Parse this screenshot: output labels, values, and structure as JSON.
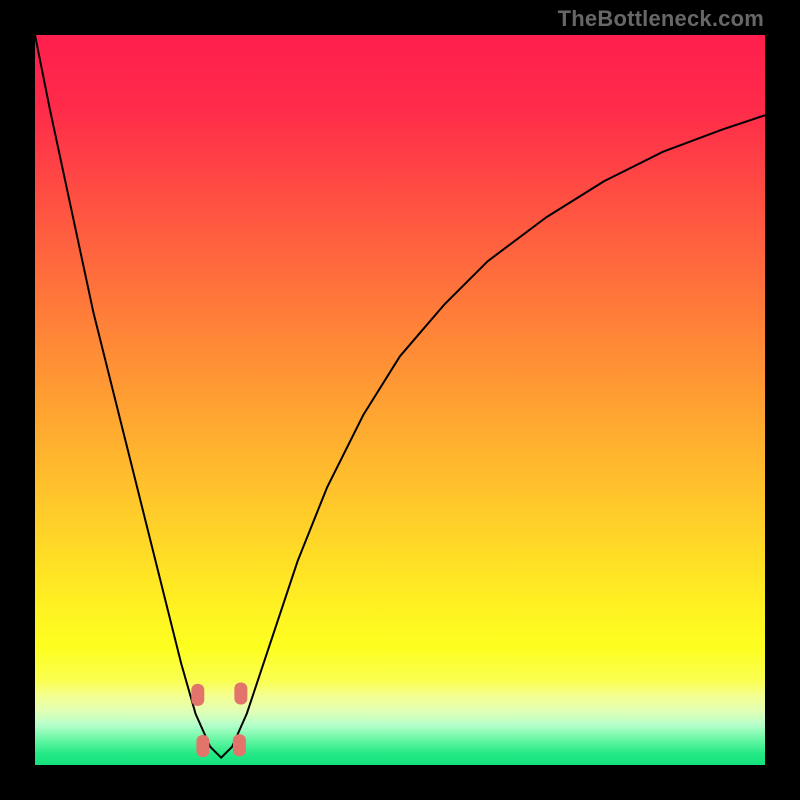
{
  "watermark": {
    "text": "TheBottleneck.com"
  },
  "gradient": {
    "stops": [
      {
        "offset": 0.0,
        "color": "#ff1f4e"
      },
      {
        "offset": 0.1,
        "color": "#ff2b4a"
      },
      {
        "offset": 0.2,
        "color": "#ff4844"
      },
      {
        "offset": 0.3,
        "color": "#ff653e"
      },
      {
        "offset": 0.4,
        "color": "#ff8238"
      },
      {
        "offset": 0.5,
        "color": "#ff9f32"
      },
      {
        "offset": 0.6,
        "color": "#ffbc2d"
      },
      {
        "offset": 0.7,
        "color": "#ffd927"
      },
      {
        "offset": 0.78,
        "color": "#fff022"
      },
      {
        "offset": 0.84,
        "color": "#fdff20"
      },
      {
        "offset": 0.885,
        "color": "#faff52"
      },
      {
        "offset": 0.905,
        "color": "#f4ff90"
      },
      {
        "offset": 0.925,
        "color": "#e3ffb4"
      },
      {
        "offset": 0.945,
        "color": "#b6ffcb"
      },
      {
        "offset": 0.965,
        "color": "#68f7a4"
      },
      {
        "offset": 0.985,
        "color": "#23e985"
      },
      {
        "offset": 1.0,
        "color": "#13e17c"
      }
    ]
  },
  "chart_data": {
    "type": "line",
    "title": "",
    "xlabel": "",
    "ylabel": "",
    "xlim": [
      0,
      100
    ],
    "ylim": [
      0,
      100
    ],
    "series": [
      {
        "name": "bottleneck-curve",
        "x": [
          0,
          2,
          5,
          8,
          12,
          16,
          20,
          22,
          24,
          25.5,
          27,
          29,
          32,
          36,
          40,
          45,
          50,
          56,
          62,
          70,
          78,
          86,
          94,
          100
        ],
        "y": [
          100,
          90,
          76,
          62,
          46,
          30,
          14,
          7,
          2.5,
          1,
          2.5,
          7,
          16,
          28,
          38,
          48,
          56,
          63,
          69,
          75,
          80,
          84,
          87,
          89
        ]
      }
    ],
    "markers": {
      "name": "pink-dots",
      "x": [
        22.3,
        23.0,
        28.0,
        28.2
      ],
      "y": [
        9.6,
        2.6,
        2.7,
        9.8
      ]
    }
  }
}
